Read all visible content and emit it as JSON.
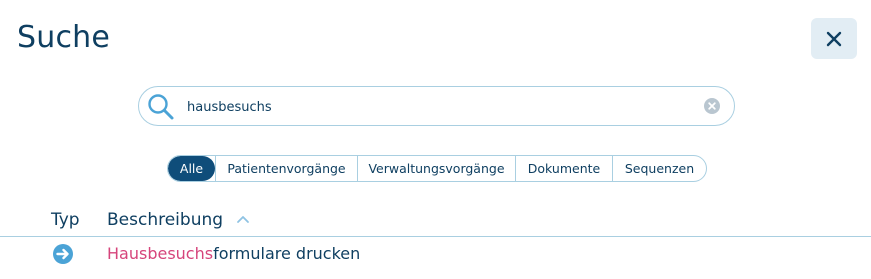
{
  "header": {
    "title": "Suche"
  },
  "close": {
    "icon": "close-icon"
  },
  "search": {
    "value": "hausbesuchs",
    "icon": "search-icon",
    "clear_icon": "clear-icon"
  },
  "filters": {
    "active": "Alle",
    "tabs": [
      {
        "label": "Alle"
      },
      {
        "label": "Patientenvorgänge"
      },
      {
        "label": "Verwaltungsvorgänge"
      },
      {
        "label": "Dokumente"
      },
      {
        "label": "Sequenzen"
      }
    ]
  },
  "table": {
    "columns": {
      "type": "Typ",
      "description": "Beschreibung"
    },
    "sort": {
      "column": "Beschreibung",
      "direction": "ascending",
      "icon": "chevron-up-icon"
    },
    "rows": [
      {
        "type_icon": "arrow-right-circle-icon",
        "description_match": "Hausbesuchs",
        "description_rest": "formulare drucken"
      }
    ]
  },
  "colors": {
    "primary": "#0f3f61",
    "active_tab": "#0f4d7a",
    "border": "#a9cfe1",
    "highlight": "#d6447b",
    "icon_accent": "#4ba3d6",
    "close_bg": "#e2edf4"
  }
}
